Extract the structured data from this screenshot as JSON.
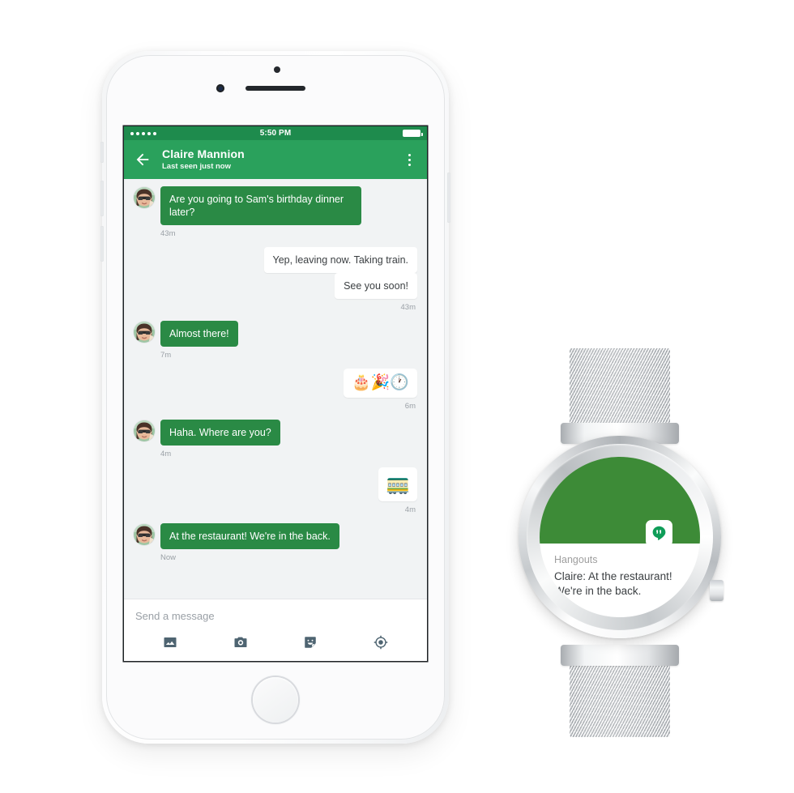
{
  "phone": {
    "status_bar": {
      "signal_dots": 5,
      "time": "5:50 PM",
      "battery_icon": "battery-full-icon"
    },
    "app_bar": {
      "back_icon": "back-arrow-icon",
      "title": "Claire Mannion",
      "subtitle": "Last seen just now",
      "overflow_icon": "overflow-menu-icon"
    },
    "conversation": [
      {
        "id": "m1",
        "side": "in",
        "kind": "text",
        "text": "Are you going to Sam's birthday dinner later?",
        "avatar": true
      },
      {
        "id": "t1",
        "side": "in",
        "kind": "time",
        "text": "43m"
      },
      {
        "id": "m2",
        "side": "out",
        "kind": "text",
        "text": "Yep, leaving now. Taking train."
      },
      {
        "id": "m3",
        "side": "out",
        "kind": "text",
        "text": "See you soon!"
      },
      {
        "id": "t2",
        "side": "out",
        "kind": "time",
        "text": "43m"
      },
      {
        "id": "m4",
        "side": "in",
        "kind": "text",
        "text": "Almost there!",
        "avatar": true
      },
      {
        "id": "t3",
        "side": "in",
        "kind": "time",
        "text": "7m"
      },
      {
        "id": "m5",
        "side": "out",
        "kind": "emoji",
        "text": "🎂🎉🕐"
      },
      {
        "id": "t4",
        "side": "out",
        "kind": "time",
        "text": "6m"
      },
      {
        "id": "m6",
        "side": "in",
        "kind": "text",
        "text": "Haha. Where are you?",
        "avatar": true
      },
      {
        "id": "t5",
        "side": "in",
        "kind": "time",
        "text": "4m"
      },
      {
        "id": "m7",
        "side": "out",
        "kind": "sticker",
        "text": "🚃"
      },
      {
        "id": "t6",
        "side": "out",
        "kind": "time",
        "text": "4m"
      },
      {
        "id": "m8",
        "side": "in",
        "kind": "text",
        "text": "At the restaurant! We're in the back.",
        "avatar": true
      },
      {
        "id": "t7",
        "side": "in",
        "kind": "time",
        "text": "Now"
      }
    ],
    "composer": {
      "placeholder": "Send a message",
      "value": "",
      "actions": [
        {
          "icon": "photo-icon"
        },
        {
          "icon": "camera-icon"
        },
        {
          "icon": "sticker-icon"
        },
        {
          "icon": "location-icon"
        }
      ]
    }
  },
  "watch": {
    "app_icon": "hangouts-icon",
    "app_name": "Hangouts",
    "notification_text": "Claire: At the restaurant! We're in the back.",
    "notification_line1": "Claire: At the restaurant!",
    "notification_line2": "We're in the back."
  },
  "colors": {
    "status_green": "#1e8b4d",
    "appbar_green": "#2aa15c",
    "bubble_green": "#2a8a45",
    "watch_green": "#3d8b37",
    "thread_bg": "#f1f3f4",
    "timestamp_gray": "#9aa0a6",
    "text_dark": "#3c4043"
  }
}
